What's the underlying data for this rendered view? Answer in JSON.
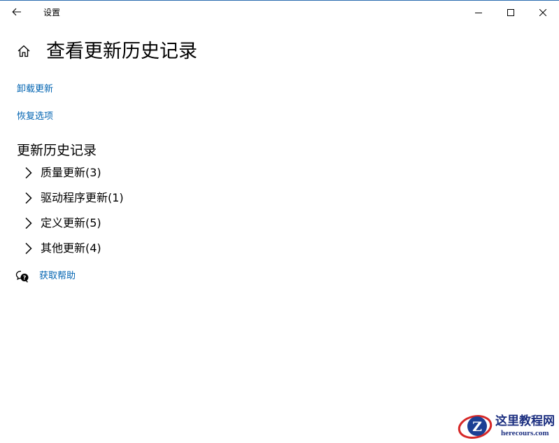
{
  "window": {
    "app_title": "设置",
    "accent_color": "#0063b1"
  },
  "icons": {
    "back": "back-arrow-icon",
    "minimize": "minimize-icon",
    "maximize": "maximize-icon",
    "close": "close-icon",
    "home": "home-icon",
    "chevron": "chevron-right-icon",
    "help": "chat-help-icon"
  },
  "page": {
    "title": "查看更新历史记录",
    "links": {
      "uninstall": "卸载更新",
      "recovery": "恢复选项"
    },
    "history_section_title": "更新历史记录",
    "history_items": [
      {
        "label": "质量更新(3)"
      },
      {
        "label": "驱动程序更新(1)"
      },
      {
        "label": "定义更新(5)"
      },
      {
        "label": "其他更新(4)"
      }
    ],
    "help_link": "获取帮助"
  },
  "watermark": {
    "logo_letter": "Z",
    "cn_text": "这里教程网",
    "en_text": "herecours.com"
  }
}
